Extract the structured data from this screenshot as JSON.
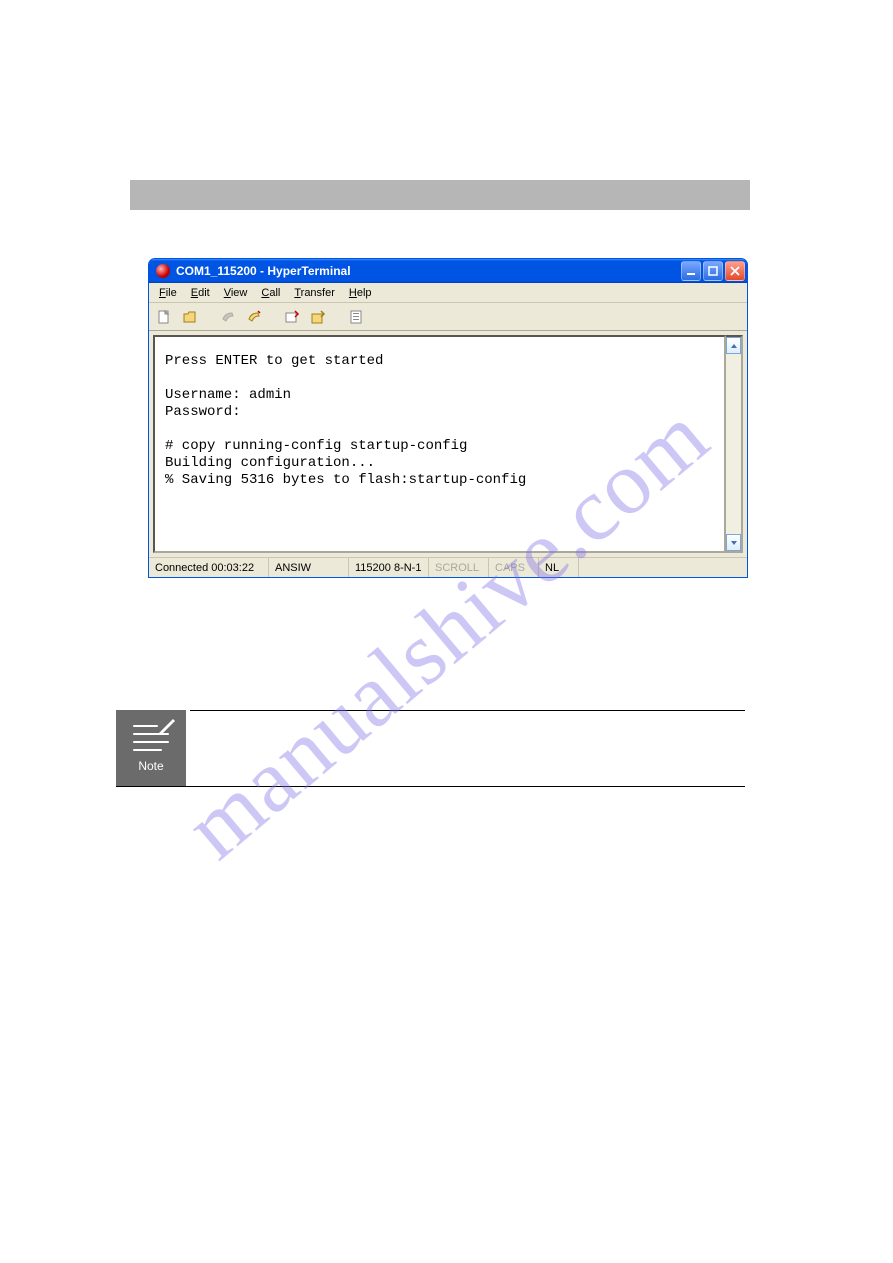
{
  "watermark_text": "manualshive.com",
  "window": {
    "title": "COM1_115200 - HyperTerminal",
    "menus": {
      "file": "File",
      "edit": "Edit",
      "view": "View",
      "call": "Call",
      "transfer": "Transfer",
      "help": "Help"
    },
    "toolbar_icons": {
      "new": "new-file-icon",
      "open": "open-folder-icon",
      "connect": "phone-connect-icon",
      "disconnect": "phone-disconnect-icon",
      "send": "send-file-icon",
      "receive": "receive-file-icon",
      "properties": "properties-icon"
    },
    "terminal_lines": [
      "Press ENTER to get started",
      "",
      "Username: admin",
      "Password:",
      "",
      "# copy running-config startup-config",
      "Building configuration...",
      "% Saving 5316 bytes to flash:startup-config"
    ],
    "status": {
      "connected": "Connected 00:03:22",
      "emulation": "ANSIW",
      "settings": "115200 8-N-1",
      "scroll": "SCROLL",
      "caps": "CAPS",
      "nl": "NL"
    }
  },
  "note_label": "Note"
}
